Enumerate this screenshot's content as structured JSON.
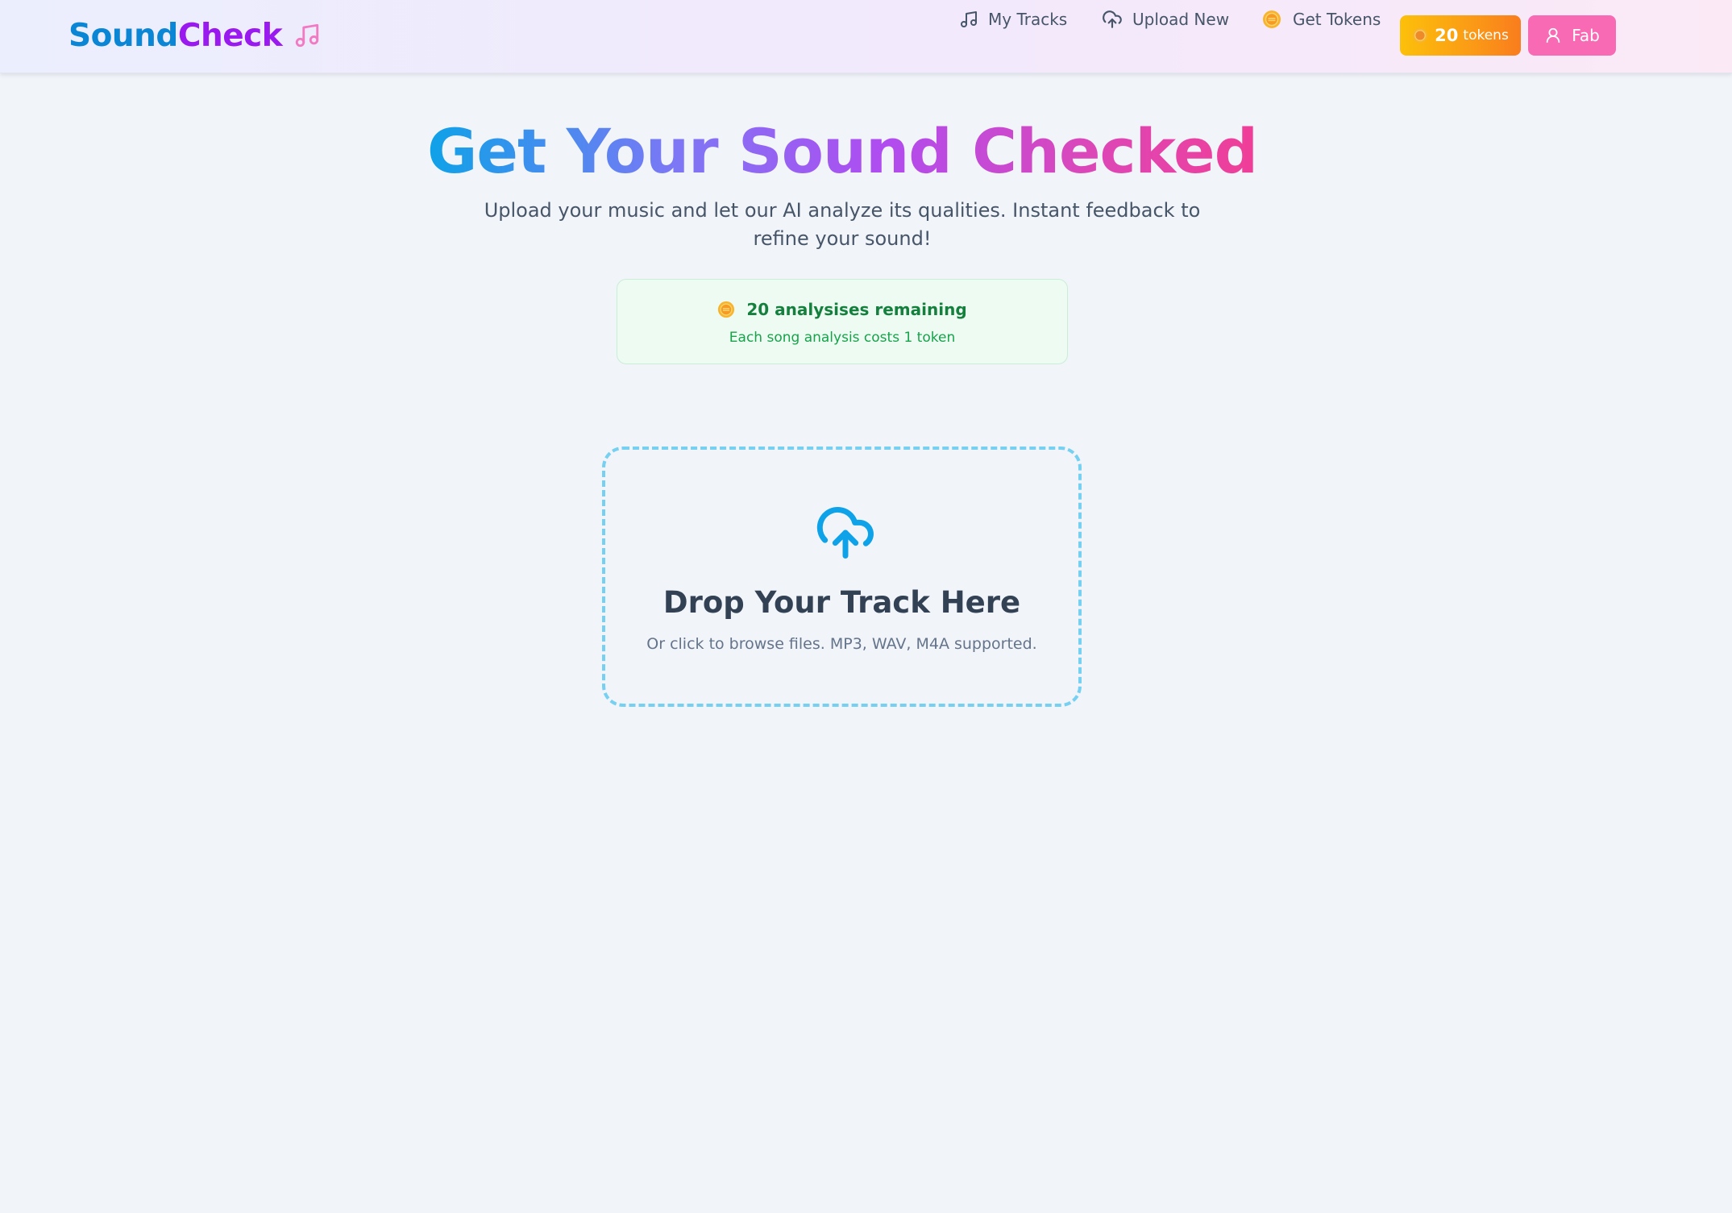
{
  "app": {
    "logo_part1": "Sound",
    "logo_part2": "Check"
  },
  "nav": {
    "my_tracks": "My Tracks",
    "upload_new": "Upload New",
    "get_tokens": "Get Tokens",
    "token_count": "20",
    "token_unit": "tokens",
    "user_name": "Fab"
  },
  "hero": {
    "title": "Get Your Sound Checked",
    "subtitle": "Upload your music and let our AI analyze its qualities. Instant feedback to refine your sound!"
  },
  "token_info": {
    "remaining": "20 analysises remaining",
    "cost_note": "Each song analysis costs 1 token"
  },
  "dropzone": {
    "title": "Drop Your Track Here",
    "hint": "Or click to browse files. MP3, WAV, M4A supported."
  },
  "icons": {
    "logo": "music-note-icon",
    "my_tracks": "music-note-icon",
    "upload_new": "cloud-upload-icon",
    "get_tokens": "coin-icon",
    "user": "user-icon",
    "dropzone": "cloud-upload-icon"
  },
  "colors": {
    "brand_blue": "#0a86d4",
    "brand_purple": "#9a19ee",
    "accent_pink": "#f86ab4",
    "token_orange": "#fb9a16",
    "success_green": "#15803d",
    "dropzone_border": "#75d0f1",
    "upload_icon_blue": "#0ea2e8"
  }
}
